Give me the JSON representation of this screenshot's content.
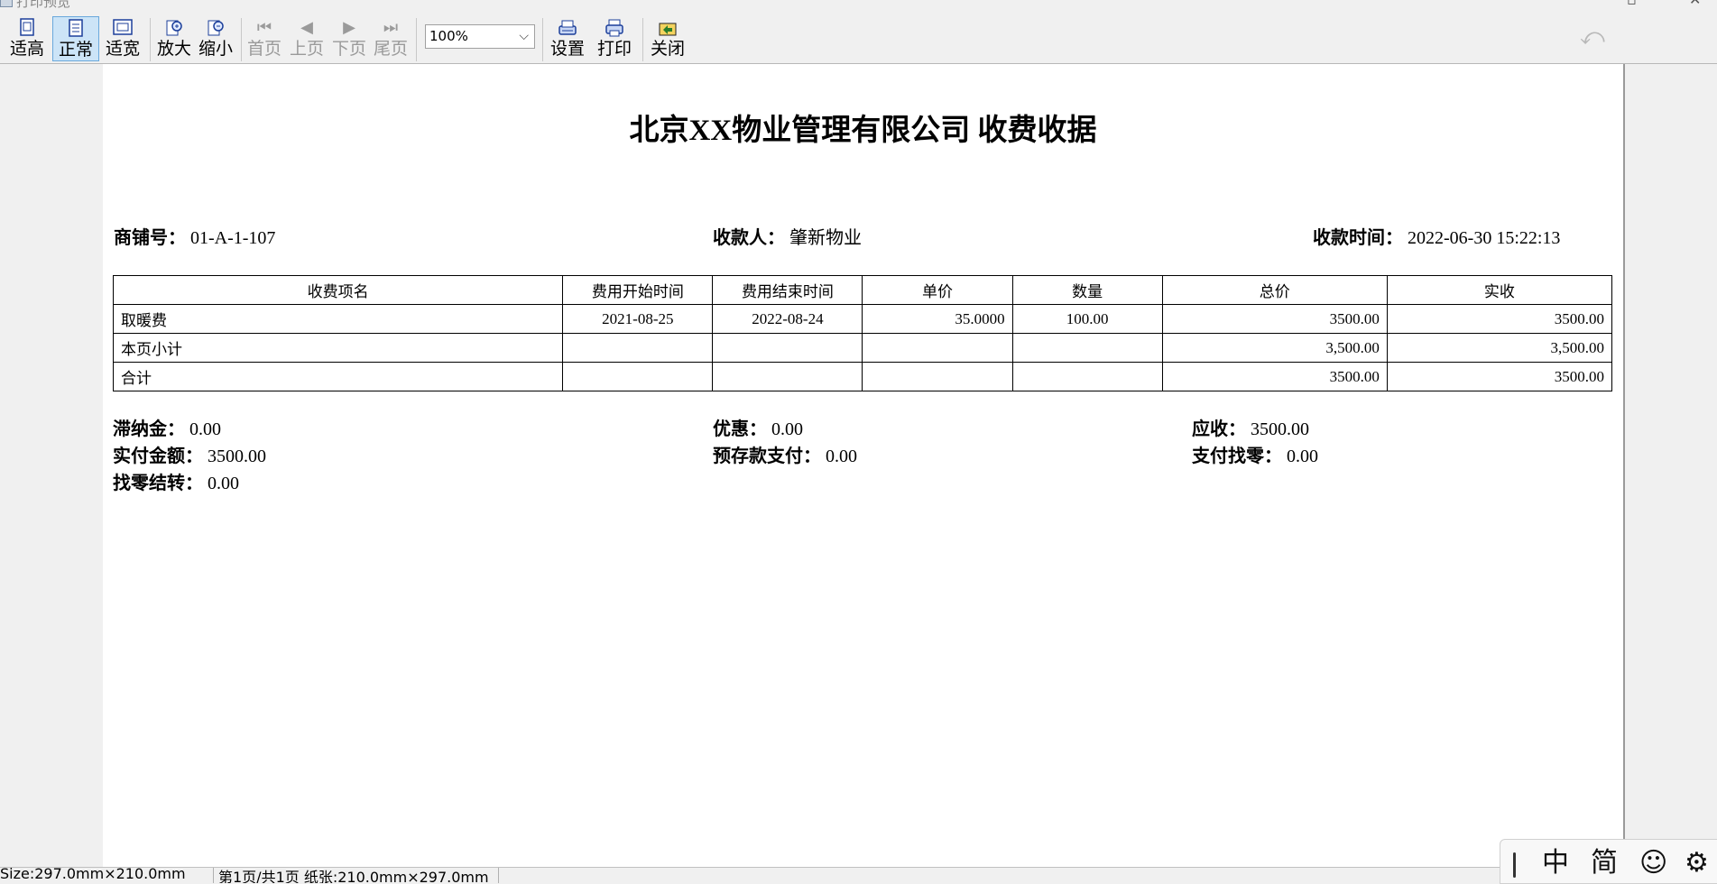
{
  "window": {
    "title": "打印预览"
  },
  "toolbar": {
    "buttons": [
      {
        "label": "适高"
      },
      {
        "label": "正常"
      },
      {
        "label": "适宽"
      },
      {
        "label": "放大"
      },
      {
        "label": "缩小"
      },
      {
        "label": "首页"
      },
      {
        "label": "上页"
      },
      {
        "label": "下页"
      },
      {
        "label": "尾页"
      },
      {
        "label": "设置"
      },
      {
        "label": "打印"
      },
      {
        "label": "关闭"
      }
    ],
    "zoom_value": "100%"
  },
  "document": {
    "title": "北京XX物业管理有限公司 收费收据",
    "shop_label": "商铺号：",
    "shop_value": "01-A-1-107",
    "payee_label": "收款人：",
    "payee_value": "肇新物业",
    "time_label": "收款时间：",
    "time_value": "2022-06-30 15:22:13",
    "table": {
      "headers": [
        "收费项名",
        "费用开始时间",
        "费用结束时间",
        "单价",
        "数量",
        "总价",
        "实收"
      ],
      "rows": [
        [
          "取暖费",
          "2021-08-25",
          "2022-08-24",
          "35.0000",
          "100.00",
          "3500.00",
          "3500.00"
        ],
        [
          "本页小计",
          "",
          "",
          "",
          "",
          "3,500.00",
          "3,500.00"
        ],
        [
          "合计",
          "",
          "",
          "",
          "",
          "3500.00",
          "3500.00"
        ]
      ]
    },
    "summary": {
      "late_fee_label": "滞纳金：",
      "late_fee_value": "0.00",
      "discount_label": "优惠：",
      "discount_value": "0.00",
      "receivable_label": "应收：",
      "receivable_value": "3500.00",
      "paid_label": "实付金额：",
      "paid_value": "3500.00",
      "prepaid_label": "预存款支付：",
      "prepaid_value": "0.00",
      "change_label": "支付找零：",
      "change_value": "0.00",
      "carry_label": "找零结转：",
      "carry_value": "0.00"
    }
  },
  "statusbar": {
    "size": "Size:297.0mm×210.0mm",
    "page": "第1页/共1页  纸张:210.0mm×297.0mm"
  },
  "ime": {
    "mode": "中",
    "charset": "简"
  }
}
